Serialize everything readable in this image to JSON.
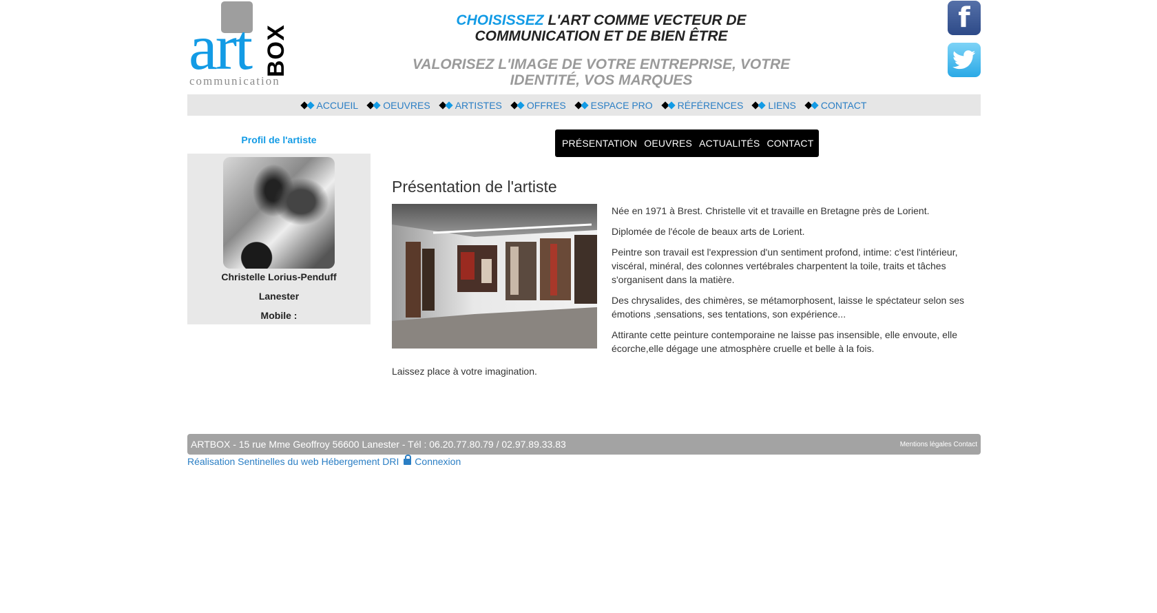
{
  "header": {
    "logo": {
      "art": "art",
      "box": "BOX",
      "sub": "communication"
    },
    "tagline_highlight": "CHOISISSEZ",
    "tagline_rest": "L'ART COMME VECTEUR DE COMMUNICATION ET DE BIEN ÊTRE",
    "subtagline": "VALORISEZ L'IMAGE DE VOTRE ENTREPRISE, VOTRE IDENTITÉ, VOS MARQUES",
    "social": [
      {
        "icon": "facebook-icon",
        "glyph": "f"
      },
      {
        "icon": "twitter-icon",
        "glyph": "🐦"
      }
    ]
  },
  "nav": {
    "items": [
      {
        "label": "ACCUEIL"
      },
      {
        "label": "OEUVRES"
      },
      {
        "label": "ARTISTES"
      },
      {
        "label": "OFFRES"
      },
      {
        "label": "ESPACE PRO"
      },
      {
        "label": "RÉFÉRENCES"
      },
      {
        "label": "LIENS"
      },
      {
        "label": "CONTACT"
      }
    ]
  },
  "sidebar": {
    "title": "Profil de l'artiste",
    "name": "Christelle Lorius-Penduff",
    "city": "Lanester",
    "mobile_label": "Mobile :"
  },
  "subnav": {
    "items": [
      {
        "label": "PRÉSENTATION"
      },
      {
        "label": "OEUVRES"
      },
      {
        "label": "ACTUALITÉS"
      },
      {
        "label": "CONTACT"
      }
    ]
  },
  "content": {
    "title": "Présentation de l'artiste",
    "paragraphs": [
      "Née en 1971 à Brest. Christelle vit et travaille en Bretagne près de Lorient.",
      "Diplomée de l'école de beaux arts de Lorient.",
      "Peintre son travail est l'expression d'un sentiment profond, intime: c'est l'intérieur, viscéral,  minéral, des colonnes vertébrales charpentent la toile, traits et tâches s'organisent dans la matière.",
      "Des chrysalides, des chimères, se métamorphosent, laisse le spéctateur selon ses émotions ,sensations, ses tentations, son expérience...",
      "Attirante cette peinture  contemporaine ne laisse pas insensible,  elle envoute, elle écorche,elle dégage une atmosphère cruelle et belle à la fois."
    ],
    "last_line": "Laissez place à votre imagination."
  },
  "footer": {
    "address": "ARTBOX - 15 rue Mme Geoffroy 56600 Lanester - Tél : 06.20.77.80.79 / 02.97.89.33.83",
    "legal": "Mentions légales",
    "contact": "Contact",
    "credits_realisation": "Réalisation Sentinelles du web",
    "credits_hosting": "Hébergement DRI",
    "credits_login": "Connexion"
  }
}
